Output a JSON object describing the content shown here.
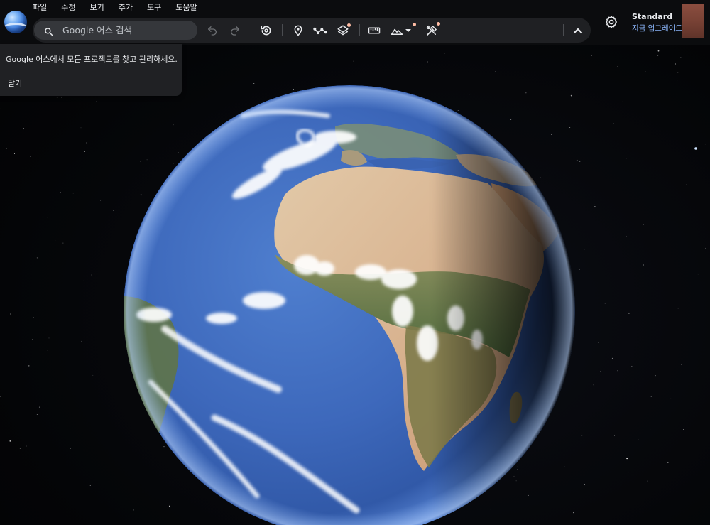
{
  "menu": {
    "items": [
      "파일",
      "수정",
      "보기",
      "추가",
      "도구",
      "도움말"
    ]
  },
  "search": {
    "placeholder": "Google 어스 검색",
    "value": ""
  },
  "toolbar": {
    "icons": [
      "undo-icon",
      "redo-icon",
      "history-icon",
      "placemark-icon",
      "path-icon",
      "layers-icon",
      "measure-icon",
      "map-style-icon",
      "tools-icon",
      "collapse-icon"
    ]
  },
  "account": {
    "plan": "Standard",
    "upgrade": "지금 업그레이드"
  },
  "tip": {
    "message": "Google 어스에서 모든 프로젝트를 찾고 관리하세요.",
    "close": "닫기"
  },
  "colors": {
    "accent": "#8ab4f8",
    "notification_dot": "#fdbba3",
    "toolbar_bg": "#1f2023",
    "search_bg": "#35373b"
  }
}
